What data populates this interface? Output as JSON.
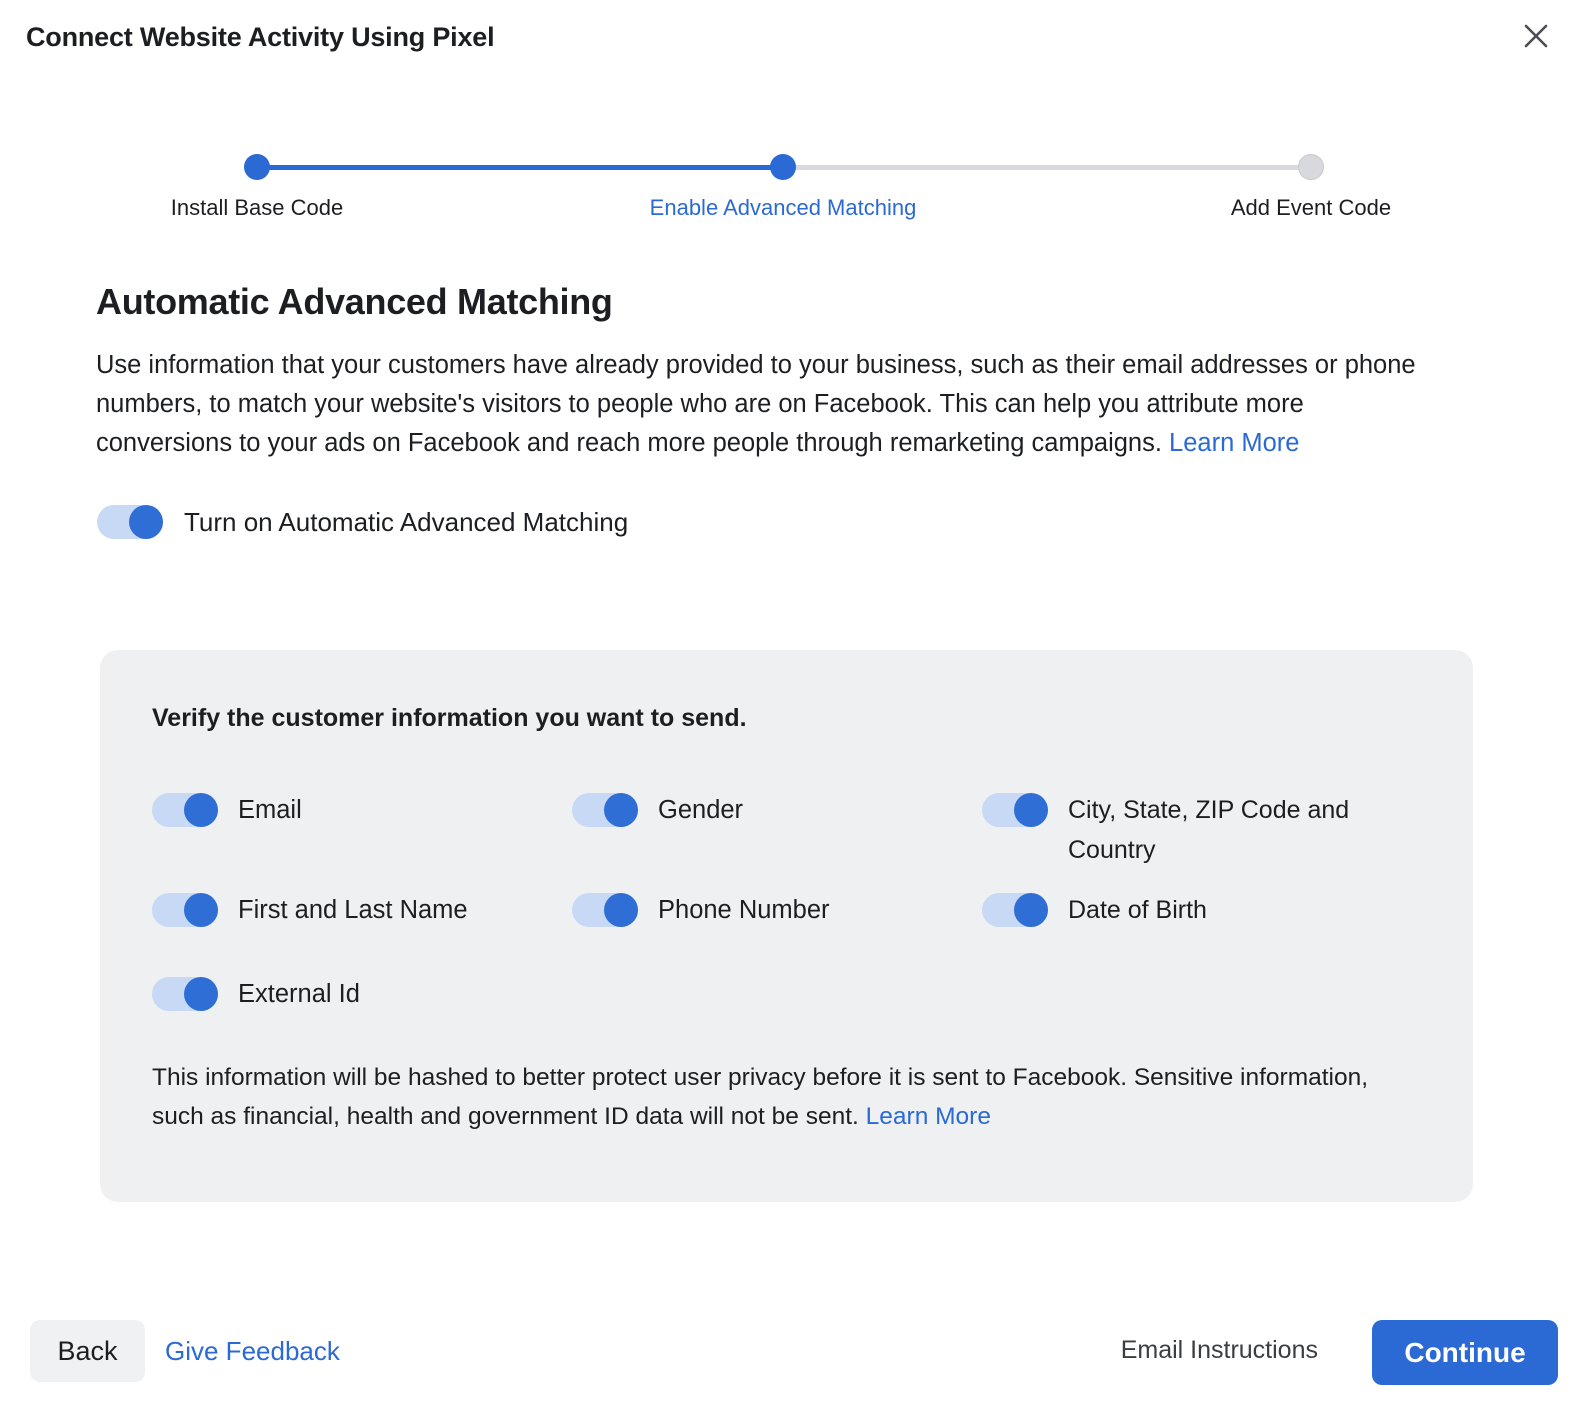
{
  "header": {
    "title": "Connect Website Activity Using Pixel",
    "close_icon": "close-icon"
  },
  "stepper": {
    "steps": [
      {
        "label": "Install Base Code",
        "state": "completed"
      },
      {
        "label": "Enable Advanced Matching",
        "state": "current"
      },
      {
        "label": "Add Event Code",
        "state": "todo"
      }
    ],
    "accent_color": "#2b6ad4",
    "inactive_color": "#d8dade"
  },
  "main": {
    "section_title": "Automatic Advanced Matching",
    "description_text": "Use information that your customers have already provided to your business, such as their email addresses or phone numbers, to match your website's visitors to people who are on Facebook. This can help you attribute more conversions to your ads on Facebook and reach more people through remarketing campaigns. ",
    "description_link": "Learn More",
    "main_toggle": {
      "label": "Turn on Automatic Advanced Matching",
      "state": "on"
    }
  },
  "panel": {
    "heading": "Verify the customer information you want to send.",
    "fields": [
      {
        "label": "Email",
        "state": "on"
      },
      {
        "label": "Gender",
        "state": "on"
      },
      {
        "label": "City, State, ZIP Code and Country",
        "state": "on"
      },
      {
        "label": "First and Last Name",
        "state": "on"
      },
      {
        "label": "Phone Number",
        "state": "on"
      },
      {
        "label": "Date of Birth",
        "state": "on"
      },
      {
        "label": "External Id",
        "state": "on"
      }
    ],
    "note_text": "This information will be hashed to better protect user privacy before it is sent to Facebook. Sensitive information, such as financial, health and government ID data will not be sent. ",
    "note_link": "Learn More"
  },
  "footer": {
    "back_label": "Back",
    "give_feedback_label": "Give Feedback",
    "email_instructions_label": "Email Instructions",
    "continue_label": "Continue"
  },
  "colors": {
    "accent": "#2b6ad4",
    "panel_bg": "#eff0f2",
    "toggle_track": "#c7d9f5",
    "text": "#1c1e21"
  }
}
